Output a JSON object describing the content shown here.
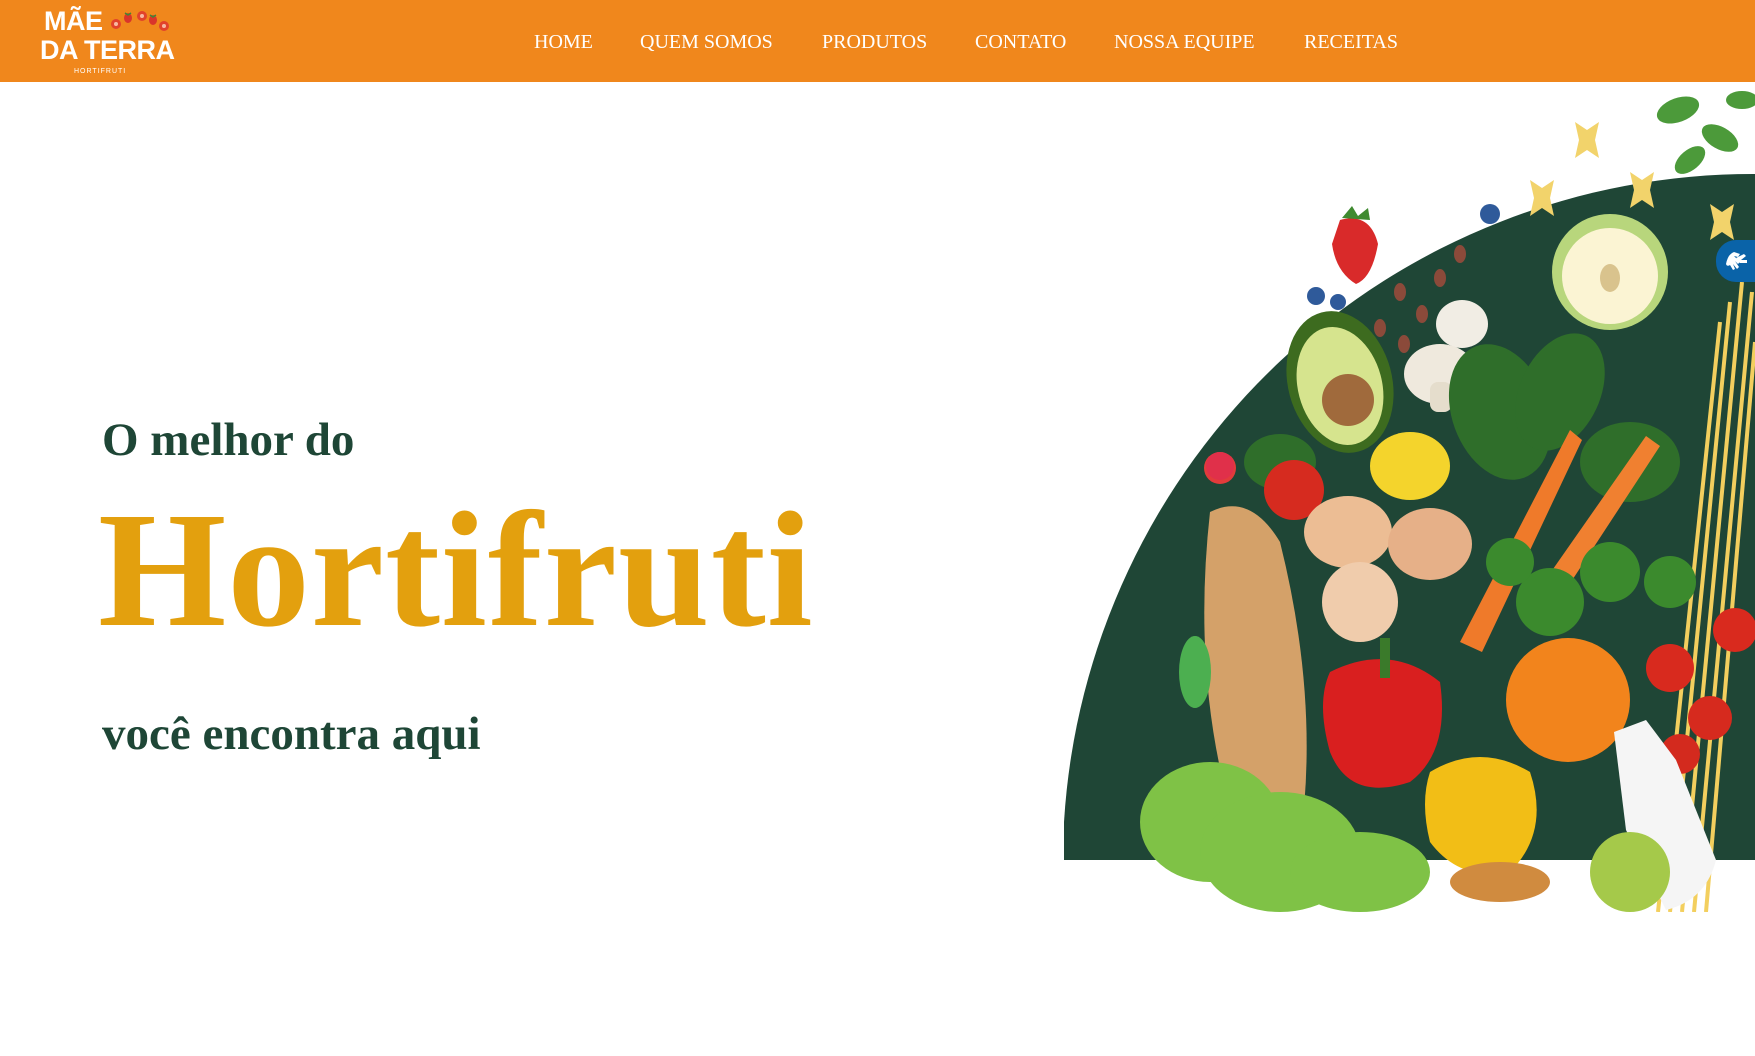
{
  "brand": {
    "line1": "MÃE",
    "line2": "DA TERRA",
    "sub": "HORTIFRUTI"
  },
  "nav": {
    "items": [
      {
        "label": "HOME"
      },
      {
        "label": "QUEM SOMOS"
      },
      {
        "label": "PRODUTOS"
      },
      {
        "label": "CONTATO"
      },
      {
        "label": "NOSSA EQUIPE"
      },
      {
        "label": "RECEITAS"
      }
    ]
  },
  "hero": {
    "line1": "O melhor do",
    "headline": "Hortifruti",
    "line2": "você encontra aqui"
  },
  "accessibility": {
    "icon": "sign-language-icon"
  },
  "colors": {
    "header": "#f0871c",
    "dark_green": "#1e4636",
    "gold": "#e3a00e",
    "accessibility_blue": "#0a63a8"
  }
}
